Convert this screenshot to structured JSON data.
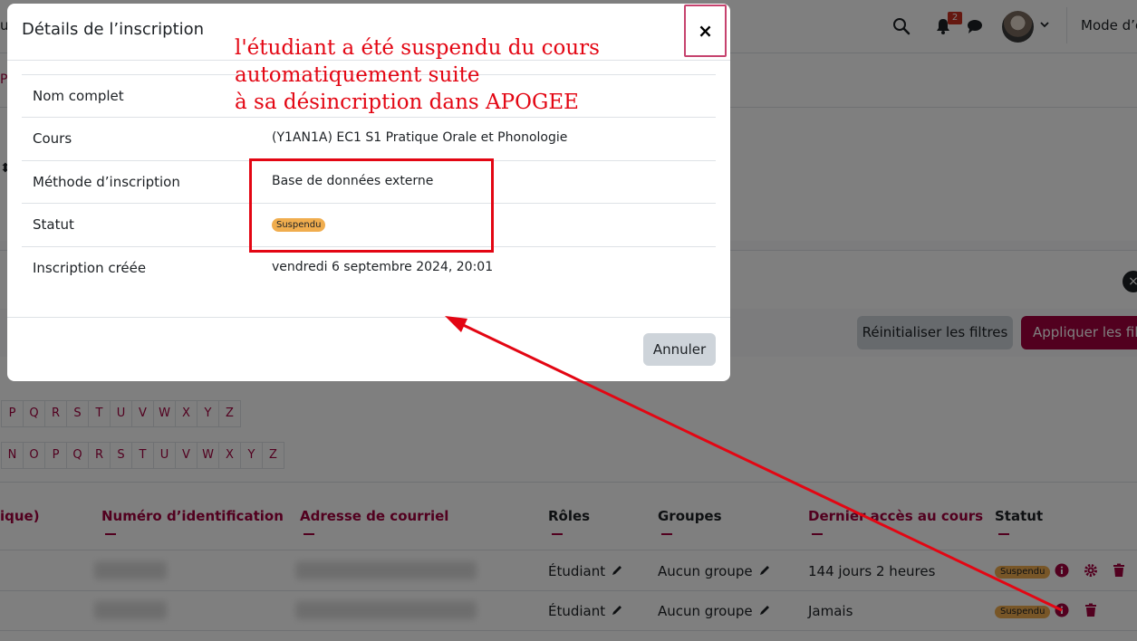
{
  "topbar": {
    "notification_count": "2",
    "mode_label": "Mode d’é",
    "left_fragment": "u"
  },
  "page": {
    "side_fragment": "Pa",
    "filters": {
      "reset_label": "Réinitialiser les filtres",
      "apply_label": "Appliquer les filtr"
    },
    "letters_row1": [
      "P",
      "Q",
      "R",
      "S",
      "T",
      "U",
      "V",
      "W",
      "X",
      "Y",
      "Z"
    ],
    "letters_row2": [
      "N",
      "O",
      "P",
      "Q",
      "R",
      "S",
      "T",
      "U",
      "V",
      "W",
      "X",
      "Y",
      "Z"
    ],
    "table": {
      "headers": {
        "name_fragment": "ique)",
        "id_number": "Numéro d’identification",
        "email": "Adresse de courriel",
        "roles": "Rôles",
        "groups": "Groupes",
        "last_access": "Dernier accès au cours",
        "status": "Statut"
      },
      "rows": [
        {
          "role": "Étudiant",
          "group": "Aucun groupe",
          "last_access": "144 jours 2 heures",
          "status": "Suspendu"
        },
        {
          "role": "Étudiant",
          "group": "Aucun groupe",
          "last_access": "Jamais",
          "status": "Suspendu"
        }
      ]
    }
  },
  "modal": {
    "title": "Détails de l’inscription",
    "close_symbol": "×",
    "rows": [
      {
        "label": "Nom complet",
        "value": ""
      },
      {
        "label": "Cours",
        "value": "(Y1AN1A) EC1 S1 Pratique Orale et Phonologie"
      },
      {
        "label": "Méthode d’inscription",
        "value": "Base de données externe"
      },
      {
        "label": "Statut",
        "value": "Suspendu"
      },
      {
        "label": "Inscription créée",
        "value": "vendredi 6 septembre 2024, 20:01"
      }
    ],
    "cancel_label": "Annuler"
  },
  "annotation": {
    "line1": "l'étudiant a été suspendu du cours",
    "line2": "automatiquement suite",
    "line3": "à sa désincription dans APOGEE",
    "color": "#e30613"
  },
  "colors": {
    "brand": "#a5003f",
    "suspended_badge": "#f0ad4e",
    "annotation_red": "#e30613"
  }
}
